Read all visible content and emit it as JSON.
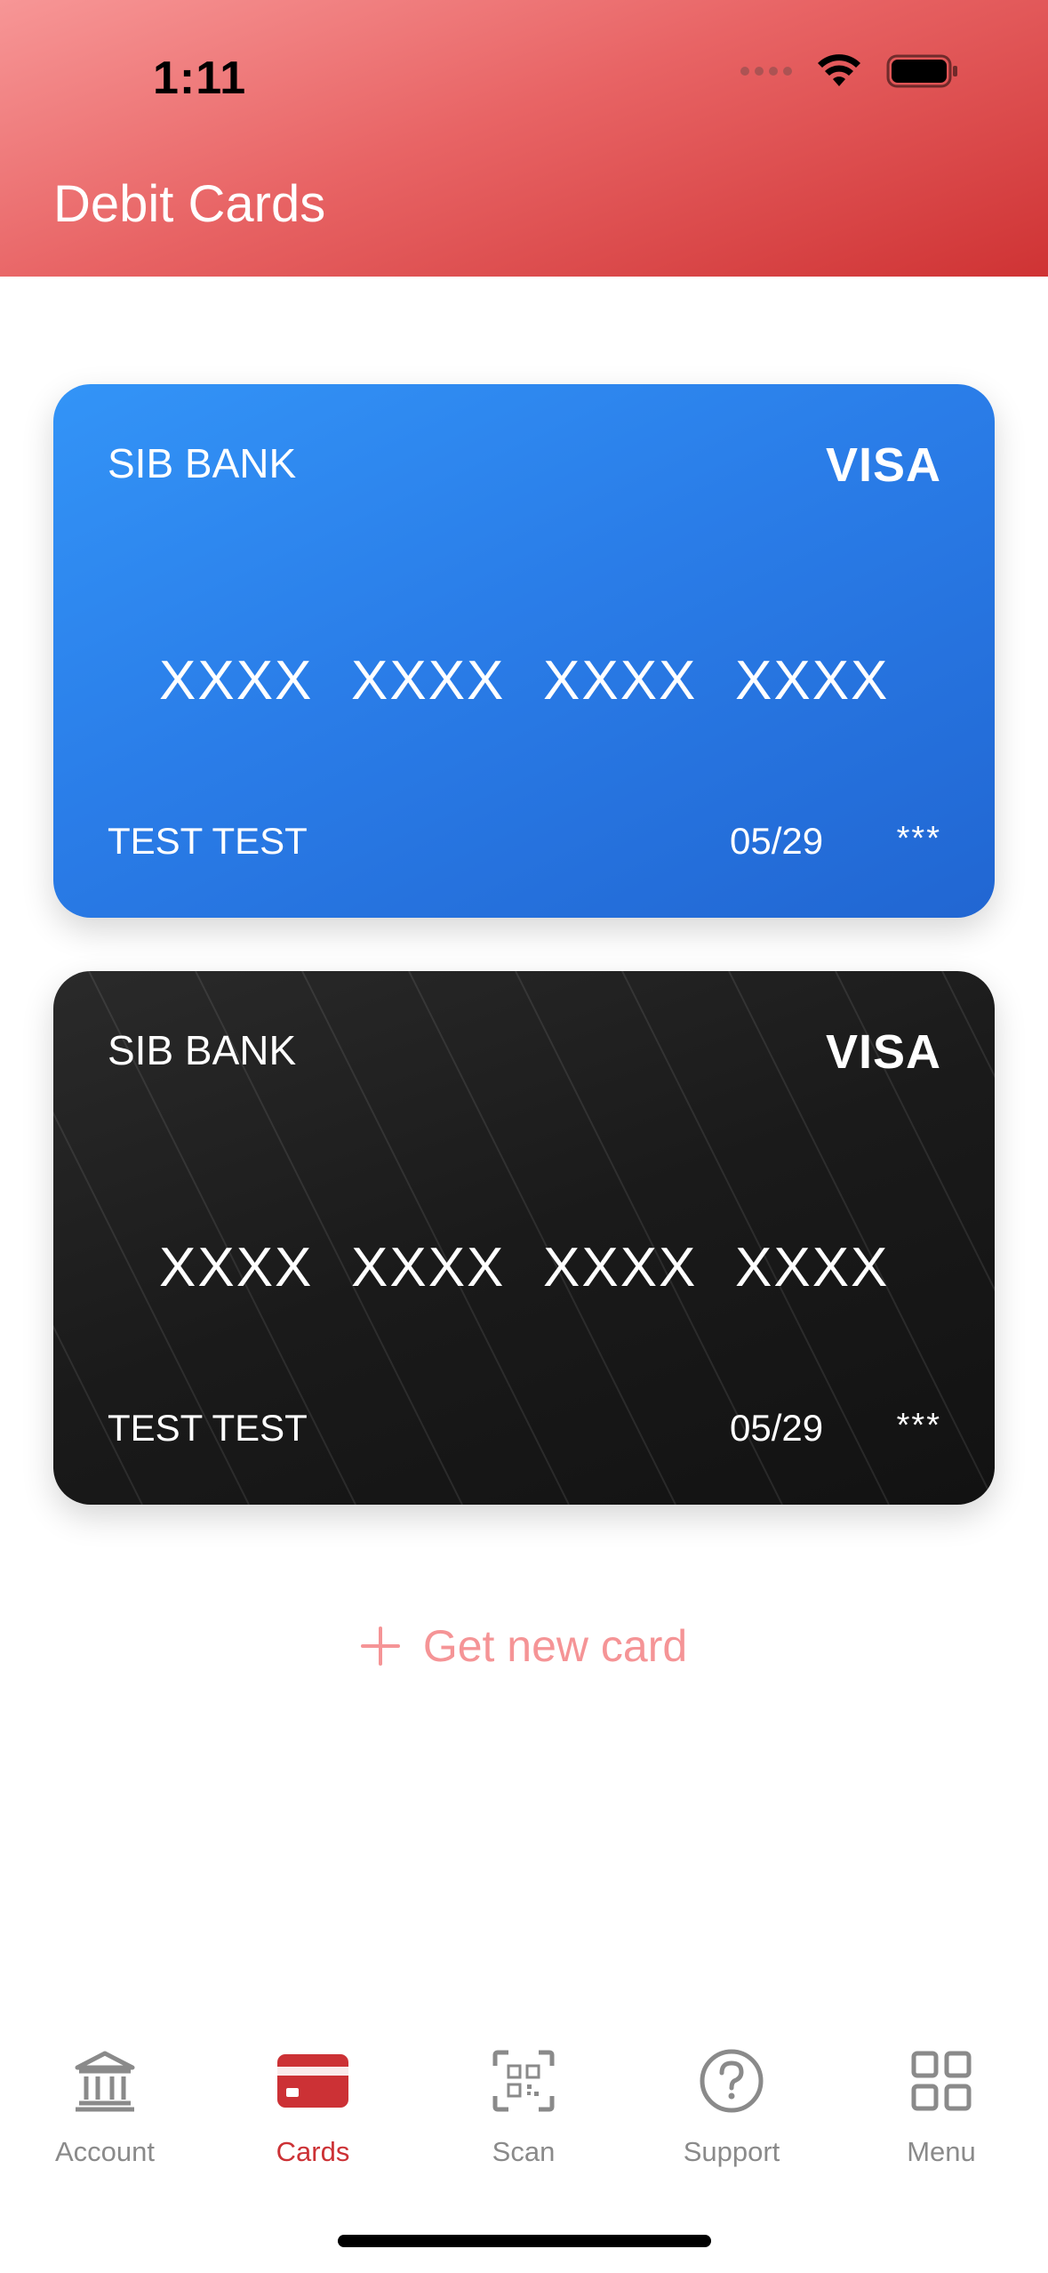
{
  "status": {
    "time": "1:11"
  },
  "header": {
    "title": "Debit Cards"
  },
  "cards": [
    {
      "style": "blue",
      "bank": "SIB BANK",
      "brand": "VISA",
      "number_groups": [
        "XXXX",
        "XXXX",
        "XXXX",
        "XXXX"
      ],
      "holder": "TEST TEST",
      "expiry": "05/29",
      "cvv": "***"
    },
    {
      "style": "black",
      "bank": "SIB BANK",
      "brand": "VISA",
      "number_groups": [
        "XXXX",
        "XXXX",
        "XXXX",
        "XXXX"
      ],
      "holder": "TEST TEST",
      "expiry": "05/29",
      "cvv": "***"
    }
  ],
  "get_new_card": {
    "label": "Get new card"
  },
  "tabbar": {
    "active": "cards",
    "items": [
      {
        "id": "account",
        "label": "Account",
        "icon": "bank-icon"
      },
      {
        "id": "cards",
        "label": "Cards",
        "icon": "card-icon"
      },
      {
        "id": "scan",
        "label": "Scan",
        "icon": "qr-scan-icon"
      },
      {
        "id": "support",
        "label": "Support",
        "icon": "question-icon"
      },
      {
        "id": "menu",
        "label": "Menu",
        "icon": "grid-icon"
      }
    ]
  },
  "colors": {
    "accent": "#cc3135",
    "header_light": "#f79696",
    "header_dark": "#cf3334",
    "card_blue": "#2a7de8",
    "card_black": "#1a1a1a",
    "get_card_text": "#f59496",
    "inactive_tab": "#8a8a8a"
  }
}
